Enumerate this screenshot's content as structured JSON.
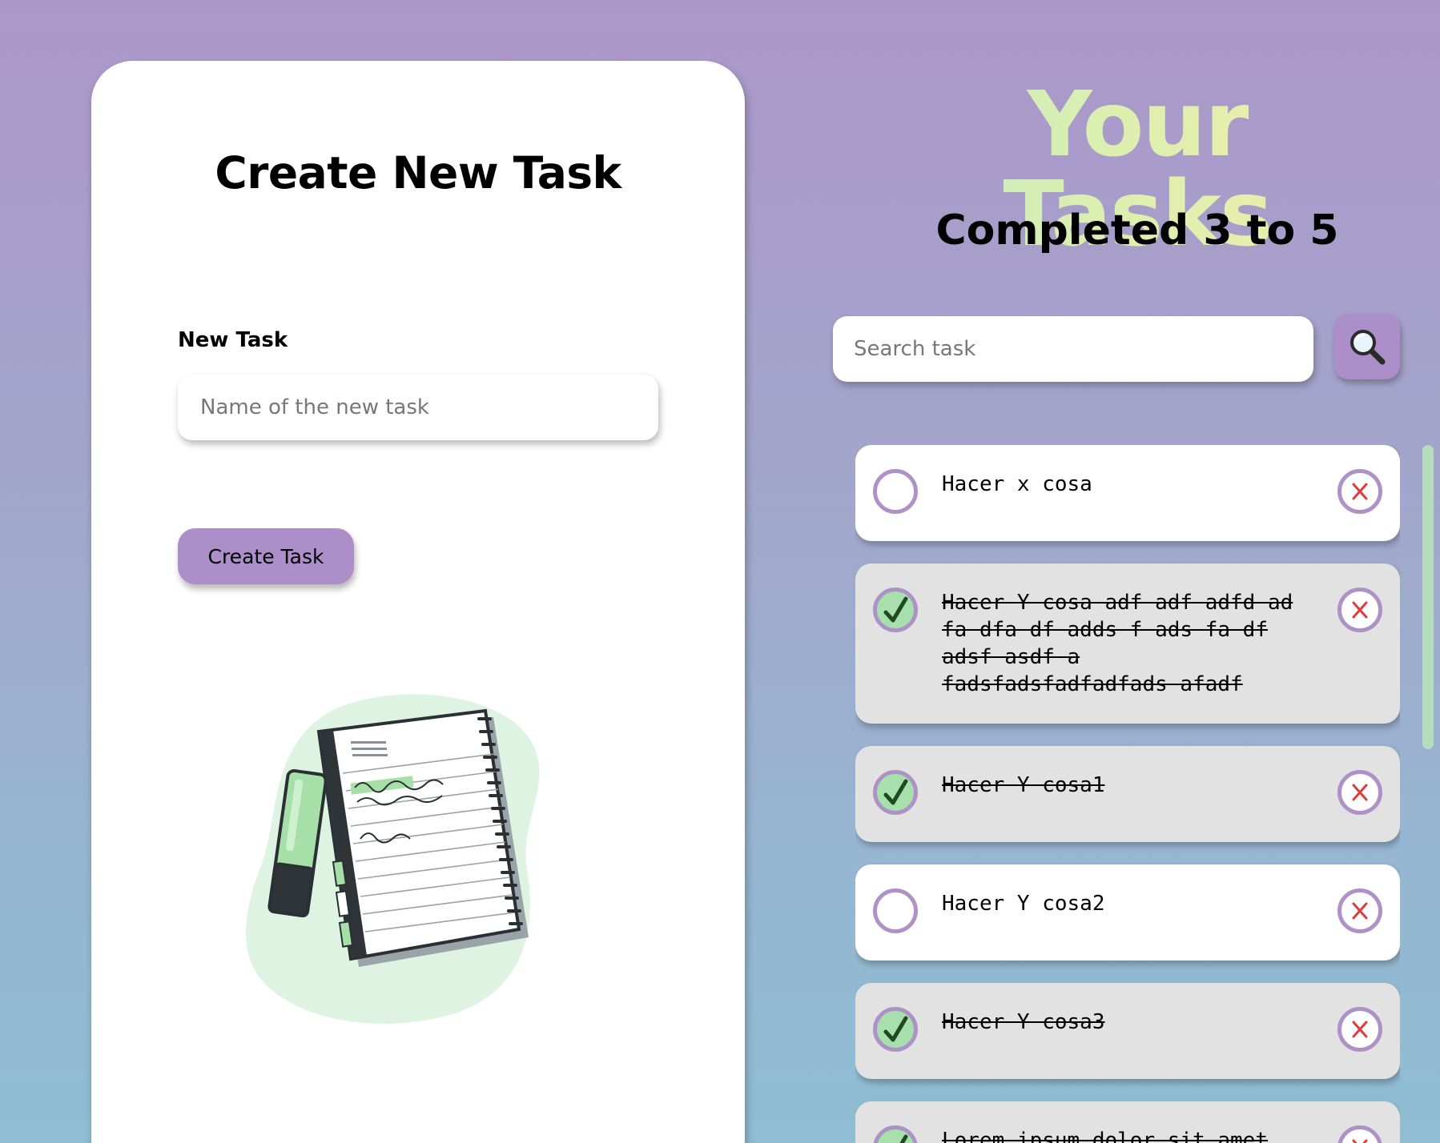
{
  "create_panel": {
    "title": "Create New Task",
    "field_label": "New Task",
    "input_value": "",
    "input_placeholder": "Name of the new task",
    "button_label": "Create Task",
    "illustration_icon": "notebook-illustration"
  },
  "header": {
    "title": "Your Tasks",
    "completed_text": "Completed 3 to 5"
  },
  "search": {
    "value": "",
    "placeholder": "Search task",
    "button_icon": "search-icon"
  },
  "tasks": [
    {
      "text": "Hacer x cosa",
      "completed": false
    },
    {
      "text": "Hacer Y cosa adf adf adfd ad fa dfa df adds f ads fa df adsf asdf a fadsfadsfadfadfads afadf",
      "completed": true
    },
    {
      "text": "Hacer Y cosa1",
      "completed": true
    },
    {
      "text": "Hacer Y cosa2",
      "completed": false
    },
    {
      "text": "Hacer Y cosa3",
      "completed": true
    },
    {
      "text": "Lorem ipsum dolor sit amet",
      "completed": true
    }
  ],
  "colors": {
    "accent": "#ac8fc8",
    "check_fill": "#a7e0ad",
    "delete_x": "#e03a3a",
    "done_card": "#e2e2e2"
  }
}
